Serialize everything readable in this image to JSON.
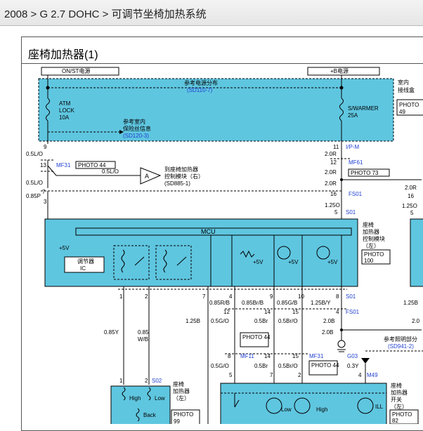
{
  "breadcrumb": "2008 > G 2.7 DOHC > 可调节坐椅加热系统",
  "title": "座椅加热器(1)",
  "power": {
    "on_st": "ON/ST电源",
    "b_plus": "+B电源"
  },
  "fusebox": {
    "ref_dist_a": "参考电源分布",
    "ref_dist_b": "(SD110-7)",
    "atm": [
      "ATM",
      "LOCK",
      "10A"
    ],
    "ref_prot_a": "参考室内",
    "ref_prot_b": "保险丝信息",
    "ref_prot_c": "(SD120-3)",
    "warmer": [
      "S/WARMER",
      "25A"
    ],
    "junction": [
      "室内",
      "接线盒"
    ],
    "photo": [
      "PHOTO",
      "49"
    ]
  },
  "connectors": {
    "mf31": "MF31",
    "photo44": "PHOTO 44",
    "ipm": "I/P-M",
    "mf61": "MF61",
    "photo73": "PHOTO 73",
    "fs01": "FS01",
    "s01": "S01",
    "s02": "S02",
    "mf11": "MF11",
    "g03": "G03",
    "m49": "M49"
  },
  "goto_right": [
    "到座椅加热器",
    "控制模块（右）",
    "(SD885-1)"
  ],
  "module": {
    "mcu": "MCU",
    "plus5v": "+5V",
    "regulator": [
      "调节器",
      "IC"
    ],
    "label": [
      "座椅",
      "加热器",
      "控制模块",
      "（左）"
    ],
    "photo": [
      "PHOTO",
      "100"
    ]
  },
  "heater": {
    "high": "High",
    "low": "Low",
    "back": "Back",
    "label": [
      "座椅",
      "加热器",
      "（左）"
    ],
    "photo": "PHOTO",
    "photo_num": "99"
  },
  "switch": {
    "low": "Low",
    "high": "High",
    "ill": "ILL",
    "label": [
      "座椅",
      "加热器",
      "开关",
      "（左）"
    ],
    "photo": [
      "PHOTO",
      "82"
    ]
  },
  "lighting_ref": [
    "参考照明部分",
    "(SD941-2)"
  ],
  "wires": {
    "w_05lo": "0.5L/O",
    "w_05p": "0.85P",
    "w_05lo2": "0.5L/O",
    "w_20r_a": "2.0R",
    "w_20r_b": "2.0R",
    "w_20r_c": "2.0R",
    "w_125o": "1.25O",
    "w_085y": "0.85Y",
    "w_085wb": [
      "0.85",
      "W/B"
    ],
    "w_125b": "1.25B",
    "w_085rb": "0.85R/B",
    "w_085brb": "0.85Br/B",
    "w_085gb": "0.85G/B",
    "w_125by": "1.25B/Y",
    "w_05go": "0.5G/O",
    "w_05br": "0.5Br",
    "w_05bro": "0.5Br/O",
    "w_20b": "2.0B",
    "w_20b2": "2.0B",
    "w_05go2": "0.5G/O",
    "w_05br2": "0.5Br",
    "w_05bro2": "0.5Br/O",
    "w_03y": "0.3Y",
    "w_right_20r": "2.0R",
    "w_right_125o": "1.25O",
    "w_right_125b": "1.25B",
    "w_right_20": "2.0"
  },
  "pins": {
    "p9": "9",
    "p13": "13",
    "p7": "7",
    "p3": "3",
    "p11": "11",
    "p12": "12",
    "p16": "16",
    "p5": "5",
    "p16r": "16",
    "p5r": "5",
    "p2r": "2.0R",
    "m1": "1",
    "m2": "2",
    "m7": "7",
    "m4": "4",
    "m9": "9",
    "m10": "10",
    "m8": "8",
    "c12": "12",
    "c14": "14",
    "c15": "15",
    "c4": "4",
    "c2": "2",
    "d8": "8",
    "d14": "14",
    "d15": "15",
    "d4": "4",
    "e5": "5",
    "e7": "7",
    "e2": "2",
    "e1": "1",
    "h1": "1",
    "h2": "2",
    "a_label": "A"
  }
}
